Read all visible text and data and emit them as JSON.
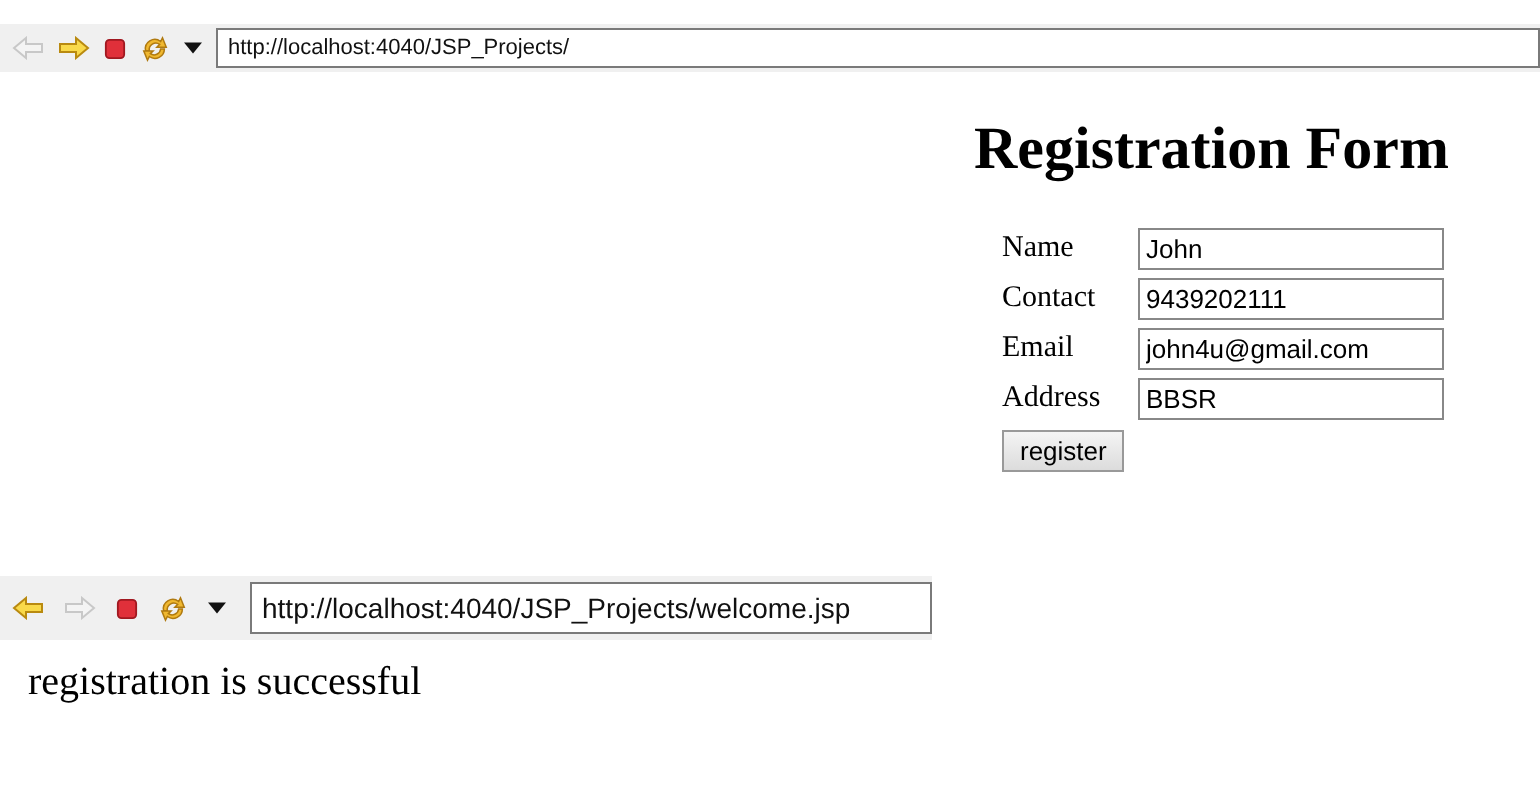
{
  "browsers": [
    {
      "toolbar": {
        "back_enabled": false,
        "forward_enabled": true,
        "url": "http://localhost:4040/JSP_Projects/"
      },
      "page": {
        "kind": "form",
        "title": "Registration Form",
        "fields": [
          {
            "label": "Name",
            "value": "John"
          },
          {
            "label": "Contact",
            "value": "9439202111"
          },
          {
            "label": "Email",
            "value": "john4u@gmail.com"
          },
          {
            "label": "Address",
            "value": "BBSR"
          }
        ],
        "button": "register"
      }
    },
    {
      "toolbar": {
        "back_enabled": true,
        "forward_enabled": false,
        "url": "http://localhost:4040/JSP_Projects/welcome.jsp"
      },
      "page": {
        "kind": "message",
        "text": "registration is successful"
      }
    }
  ]
}
